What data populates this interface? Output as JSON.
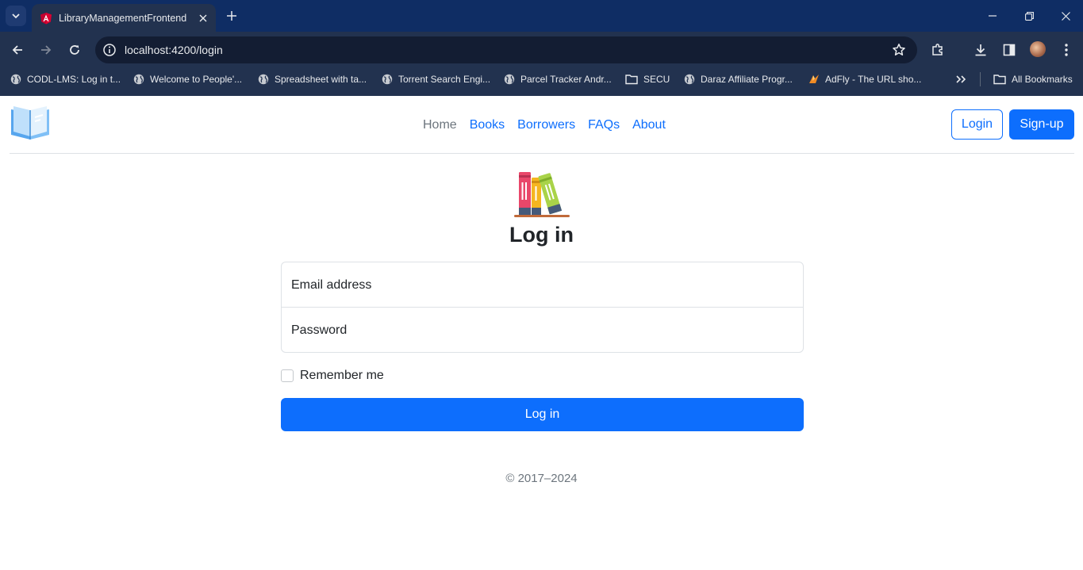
{
  "browser": {
    "tab_title": "LibraryManagementFrontend",
    "url": "localhost:4200/login",
    "bookmarks": [
      "CODL-LMS: Log in t...",
      "Welcome to People'...",
      "Spreadsheet with ta...",
      "Torrent Search Engi...",
      "Parcel Tracker Andr...",
      "SECU",
      "Daraz Affiliate Progr...",
      "AdFly - The URL sho..."
    ],
    "all_bookmarks": "All Bookmarks",
    "colors": {
      "frame": "#0f2d64",
      "toolbar": "#22324f",
      "omnibox": "#131d33"
    }
  },
  "header": {
    "nav": [
      "Home",
      "Books",
      "Borrowers",
      "FAQs",
      "About"
    ],
    "active_nav": "Home",
    "login_label": "Login",
    "signup_label": "Sign-up"
  },
  "form": {
    "title": "Log in",
    "email_placeholder": "Email address",
    "password_placeholder": "Password",
    "remember_label": "Remember me",
    "remember_checked": false,
    "submit_label": "Log in"
  },
  "footer": {
    "text": "© 2017–2024"
  },
  "colors": {
    "primary": "#0d6efd",
    "muted": "#6c757d",
    "text": "#212529",
    "border": "#dee2e6"
  }
}
